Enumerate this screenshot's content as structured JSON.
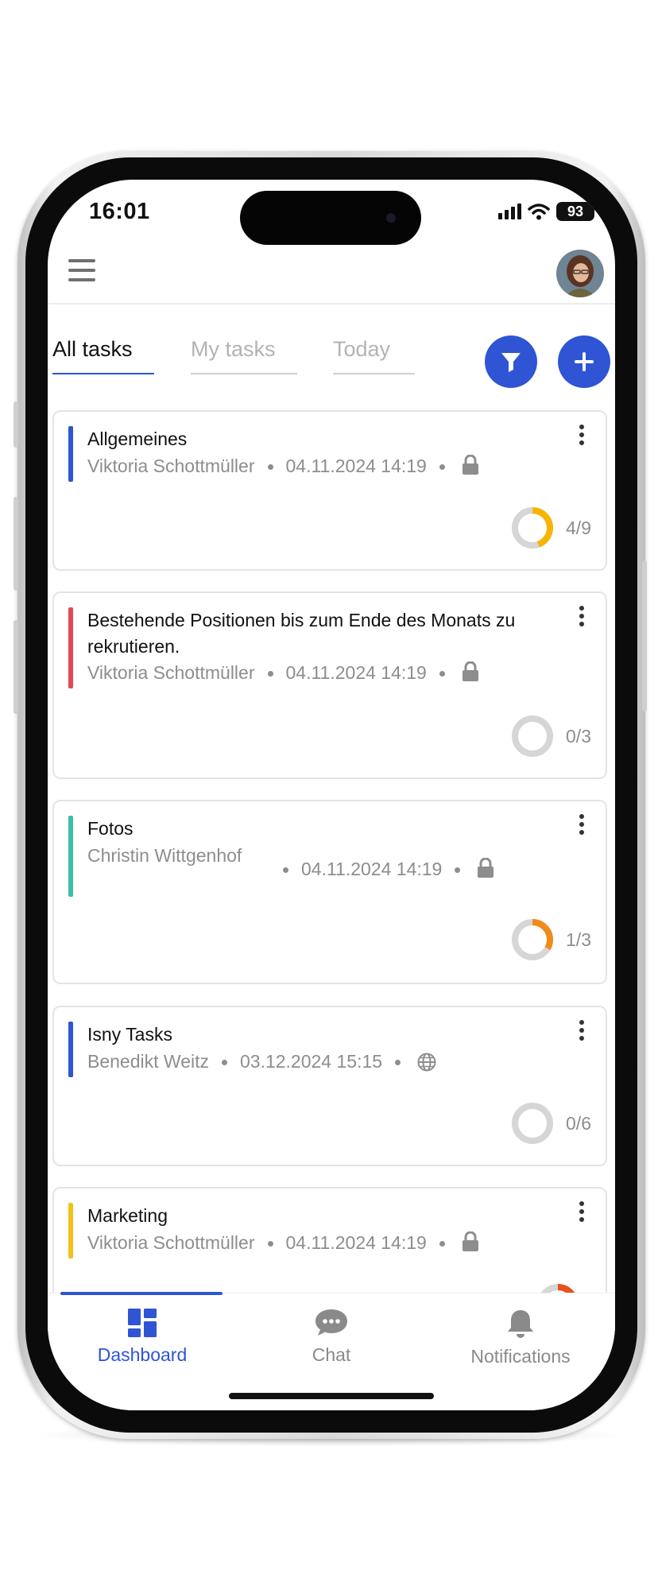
{
  "status_bar": {
    "time": "16:01",
    "battery": "93"
  },
  "header": {
    "menu_icon": "hamburger-menu-icon",
    "avatar_icon": "user-avatar"
  },
  "tabs": [
    {
      "label": "All tasks",
      "active": true
    },
    {
      "label": "My tasks",
      "active": false
    },
    {
      "label": "Today",
      "active": false
    }
  ],
  "actions": {
    "filter_icon": "filter-icon",
    "add_icon": "plus-icon"
  },
  "accent_color": "#2f55d4",
  "tasks": [
    {
      "title": "Allgemeines",
      "owner": "Viktoria Schottmüller",
      "date": "04.11.2024 14:19",
      "visibility_icon": "lock-icon",
      "progress": "4/9",
      "color": "#2f55d4"
    },
    {
      "title": "Bestehende Positionen bis zum Ende des Monats zu rekrutieren.",
      "owner": "Viktoria Schottmüller",
      "date": "04.11.2024 14:19",
      "visibility_icon": "lock-icon",
      "progress": "0/3",
      "color": "#e04a57"
    },
    {
      "title": "Fotos",
      "owner": "Christin Wittgenhof",
      "date": "04.11.2024 14:19",
      "visibility_icon": "lock-icon",
      "progress": "1/3",
      "color": "#3dbfa6"
    },
    {
      "title": "Isny Tasks",
      "owner": "Benedikt Weitz",
      "date": "03.12.2024 15:15",
      "visibility_icon": "globe-icon",
      "progress": "0/6",
      "color": "#2f55d4"
    },
    {
      "title": "Marketing",
      "owner": "Viktoria Schottmüller",
      "date": "04.11.2024 14:19",
      "visibility_icon": "lock-icon",
      "progress": "",
      "color": "#f2c21b"
    }
  ],
  "bottom_nav": [
    {
      "label": "Dashboard",
      "icon": "dashboard-icon",
      "active": true
    },
    {
      "label": "Chat",
      "icon": "chat-icon",
      "active": false
    },
    {
      "label": "Notifications",
      "icon": "bell-icon",
      "active": false
    }
  ]
}
